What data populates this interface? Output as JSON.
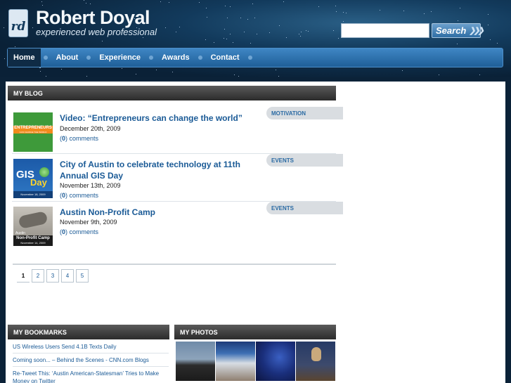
{
  "header": {
    "logo_mark": "rd",
    "site_title": "Robert Doyal",
    "tagline": "experienced web professional",
    "search": {
      "value": "",
      "button_label": "Search"
    }
  },
  "nav": {
    "items": [
      {
        "label": "Home",
        "active": true
      },
      {
        "label": "About",
        "active": false
      },
      {
        "label": "Experience",
        "active": false
      },
      {
        "label": "Awards",
        "active": false
      },
      {
        "label": "Contact",
        "active": false
      }
    ]
  },
  "blog": {
    "heading": "MY BLOG",
    "posts": [
      {
        "title": "Video: “Entrepreneurs can change the world”",
        "date": "December 20th, 2009",
        "comments_count": "0",
        "comments_label": "comments",
        "category": "MOTIVATION",
        "thumb_caption": "ENTREPRENEURS",
        "thumb_subcaption": "CAN CHANGE THE WORLD"
      },
      {
        "title": "City of Austin to celebrate technology at 11th Annual GIS Day",
        "date": "November 13th, 2009",
        "comments_count": "0",
        "comments_label": "comments",
        "category": "EVENTS",
        "thumb_caption": "GIS",
        "thumb_subcaption": "Day",
        "thumb_date": "November 18, 2009"
      },
      {
        "title": "Austin Non-Profit Camp",
        "date": "November 9th, 2009",
        "comments_count": "0",
        "comments_label": "comments",
        "category": "EVENTS",
        "thumb_caption": "Non-Profit Camp",
        "thumb_small": "Austin",
        "thumb_date": "November 14, 2009"
      }
    ],
    "pagination": [
      "1",
      "2",
      "3",
      "4",
      "5"
    ],
    "current_page": "1"
  },
  "bookmarks": {
    "heading": "MY BOOKMARKS",
    "items": [
      "US Wireless Users Send 4.1B Texts Daily",
      "Coming soon... – Behind the Scenes - CNN.com Blogs",
      "Re-Tweet This: ‘Austin American-Statesman’ Tries to Make Money on Twitter"
    ]
  },
  "photos": {
    "heading": "MY PHOTOS",
    "count": 4
  },
  "colors": {
    "link": "#1a5a96",
    "nav_gradient_top": "#3f86c4",
    "nav_gradient_bottom": "#1f5f98",
    "section_bar": "#2b2b2b",
    "category_tag_bg": "#d9dde1"
  }
}
